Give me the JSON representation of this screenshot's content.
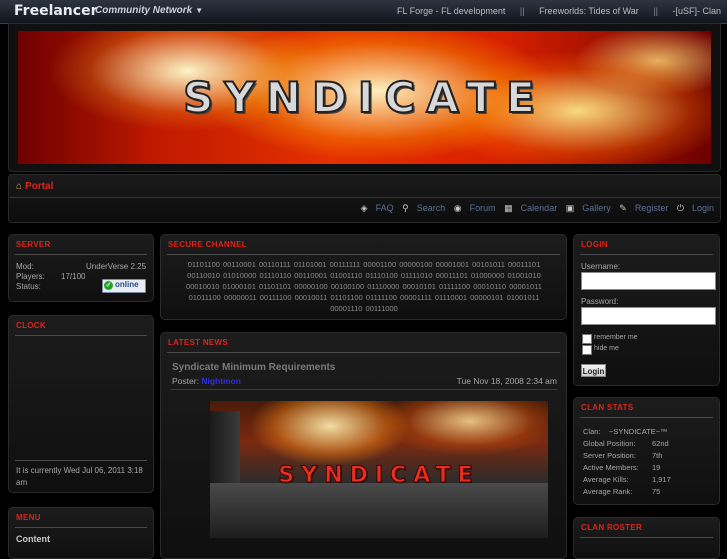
{
  "topbar": {
    "brand": "Freelancer",
    "network": "Community Network",
    "links": [
      "FL Forge - FL development",
      "Freeworlds: Tides of War",
      "-[uSF]- Clan"
    ],
    "separator": "||"
  },
  "banner": {
    "title": "SYNDICATE"
  },
  "nav": {
    "crumb": "Portal",
    "links": [
      "FAQ",
      "Search",
      "Forum",
      "Calendar",
      "Gallery",
      "Register",
      "Login"
    ]
  },
  "server": {
    "title": "SERVER",
    "mod_label": "Mod:",
    "mod_value": "UnderVerse 2.25",
    "players_label": "Players:",
    "players_value": "17/100",
    "status_label": "Status:",
    "status_value": "online"
  },
  "clock": {
    "title": "CLOCK",
    "text": "It is currently Wed Jul 06, 2011 3:18 am"
  },
  "menu": {
    "title": "MENU",
    "item": "Content"
  },
  "secure_channel": {
    "title": "SECURE CHANNEL",
    "binary": "01101100 00110001 00110111 01101001 00111111 00001100 00000100 00001001 00101011 00011101 00110010 01010000 01110110 00110001 01001110 01110100 01111010 00011101 01000000 01001010 00010010 01000101 01101101 00000100 00100100 01110000 00010101 01111100 00010110 00001011 01011100 00000011 00111100 00010011 01101100 01111100 00001111 01110001 00000101 01001011 00001110 00111000"
  },
  "latest_news": {
    "title": "LATEST NEWS",
    "post_title": "Syndicate Minimum Requirements",
    "poster_label": "Poster:",
    "poster_name": "Nightmon",
    "date": "Tue Nov 18, 2008 2:34 am",
    "image_text": "SYNDICATE"
  },
  "login": {
    "title": "LOGIN",
    "username_label": "Username:",
    "password_label": "Password:",
    "remember_label": "remember me",
    "hide_label": "hide me",
    "button": "Login"
  },
  "clan_stats": {
    "title": "CLAN STATS",
    "rows": [
      {
        "label": "Clan:",
        "value": "~SYNDICATE~™"
      },
      {
        "label": "Global Position:",
        "value": "62nd"
      },
      {
        "label": "Server Position:",
        "value": "7th"
      },
      {
        "label": "Active Members:",
        "value": "19"
      },
      {
        "label": "Average Kills:",
        "value": "1,917"
      },
      {
        "label": "Average Rank:",
        "value": "75"
      }
    ]
  },
  "clan_roster": {
    "title": "CLAN ROSTER"
  }
}
